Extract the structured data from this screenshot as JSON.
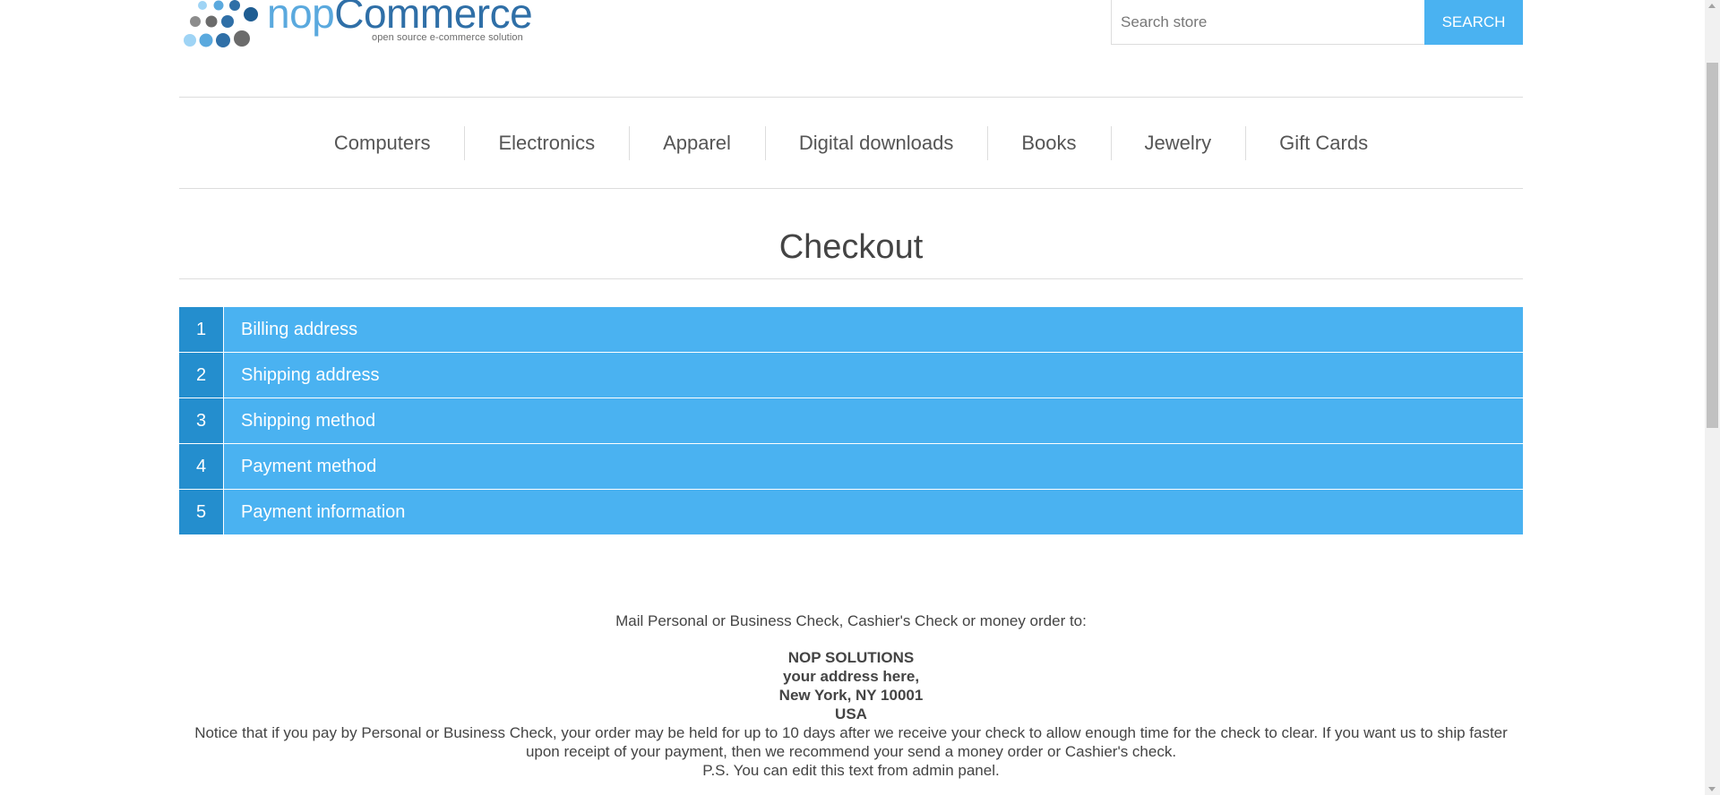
{
  "header": {
    "logo": {
      "word_light": "nop",
      "word_dark": "Commerce",
      "tagline": "open source e-commerce solution"
    },
    "search": {
      "placeholder": "Search store",
      "button_label": "SEARCH"
    }
  },
  "menu": {
    "items": [
      {
        "label": "Computers"
      },
      {
        "label": "Electronics"
      },
      {
        "label": "Apparel"
      },
      {
        "label": "Digital downloads"
      },
      {
        "label": "Books"
      },
      {
        "label": "Jewelry"
      },
      {
        "label": "Gift Cards"
      }
    ]
  },
  "page": {
    "title": "Checkout"
  },
  "steps": [
    {
      "number": "1",
      "title": "Billing address"
    },
    {
      "number": "2",
      "title": "Shipping address"
    },
    {
      "number": "3",
      "title": "Shipping method"
    },
    {
      "number": "4",
      "title": "Payment method"
    },
    {
      "number": "5",
      "title": "Payment information"
    }
  ],
  "payment_info": {
    "intro": "Mail Personal or Business Check, Cashier's Check or money order to:",
    "address_lines": [
      "NOP SOLUTIONS",
      "your address here,",
      "New York, NY 10001",
      "USA"
    ],
    "notice": "Notice that if you pay by Personal or Business Check, your order may be held for up to 10 days after we receive your check to allow enough time for the check to clear. If you want us to ship faster upon receipt of your payment, then we recommend your send a money order or Cashier's check.",
    "ps": "P.S. You can edit this text from admin panel."
  },
  "colors": {
    "accent": "#4ab2f1",
    "accent_dark": "#248ece",
    "logo_blue": "#4795cf",
    "text": "#444444"
  }
}
